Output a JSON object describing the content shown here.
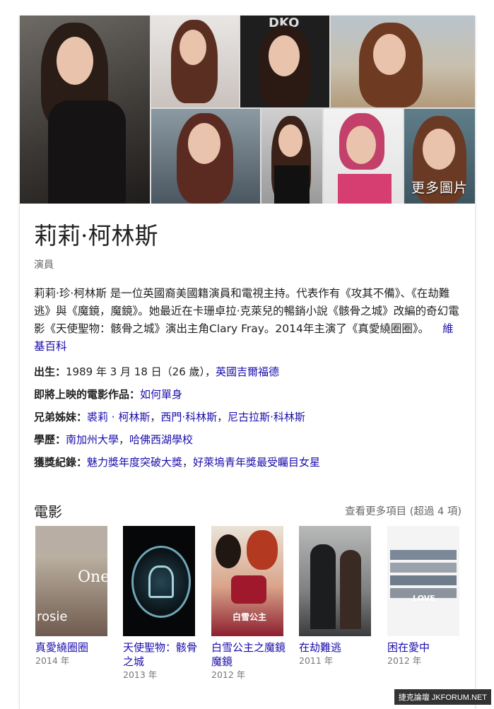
{
  "knowledge_panel": {
    "more_photos_label": "更多圖片",
    "name": "莉莉·柯林斯",
    "subtitle": "演員",
    "description_text": "莉莉·珍·柯林斯 是一位英國裔美國籍演員和電視主持。代表作有《攻其不備》、《在劫難逃》與《魔鏡，魔鏡》。她最近在卡珊卓拉·克萊兒的暢銷小說《骸骨之城》改編的奇幻電影《天使聖物：骸骨之城》演出主角Clary Fray。2014年主演了《真愛繞圈圈》。",
    "wiki_link": "維基百科",
    "facts": [
      {
        "label": "出生：",
        "parts": [
          {
            "text": "1989 年 3 月 18 日（26 歲），",
            "link": false
          },
          {
            "text": "英國吉爾福德",
            "link": true
          }
        ]
      },
      {
        "label": "即將上映的電影作品：",
        "parts": [
          {
            "text": "如何單身",
            "link": true
          }
        ]
      },
      {
        "label": "兄弟姊妹：",
        "parts": [
          {
            "text": "裘莉 · 柯林斯",
            "link": true
          },
          {
            "text": "，",
            "link": false
          },
          {
            "text": "西門·科林斯",
            "link": true
          },
          {
            "text": "，",
            "link": false
          },
          {
            "text": "尼古拉斯·科林斯",
            "link": true
          }
        ]
      },
      {
        "label": "學歷：",
        "parts": [
          {
            "text": "南加州大學",
            "link": true
          },
          {
            "text": "，",
            "link": false
          },
          {
            "text": "哈佛西湖學校",
            "link": true
          }
        ]
      },
      {
        "label": "獲獎紀錄：",
        "parts": [
          {
            "text": "魅力獎年度突破大獎",
            "link": true
          },
          {
            "text": "，",
            "link": false
          },
          {
            "text": "好萊塢青年獎最受矚目女星",
            "link": true
          }
        ]
      }
    ],
    "movies_section": {
      "title": "電影",
      "see_more": "查看更多項目 (超過 4 項)",
      "items": [
        {
          "title": "真愛繞圈圈",
          "year": "2014 年"
        },
        {
          "title": "天使聖物：骸骨之城",
          "year": "2013 年"
        },
        {
          "title": "白雪公主之魔鏡魔鏡",
          "year": "2012 年"
        },
        {
          "title": "在劫難逃",
          "year": "2011 年"
        },
        {
          "title": "困在愛中",
          "year": "2012 年"
        }
      ]
    }
  },
  "watermark": "捷克論壇 JKFORUM.NET",
  "colors": {
    "link": "#1a0dab",
    "muted": "#666666",
    "text": "#222222"
  }
}
